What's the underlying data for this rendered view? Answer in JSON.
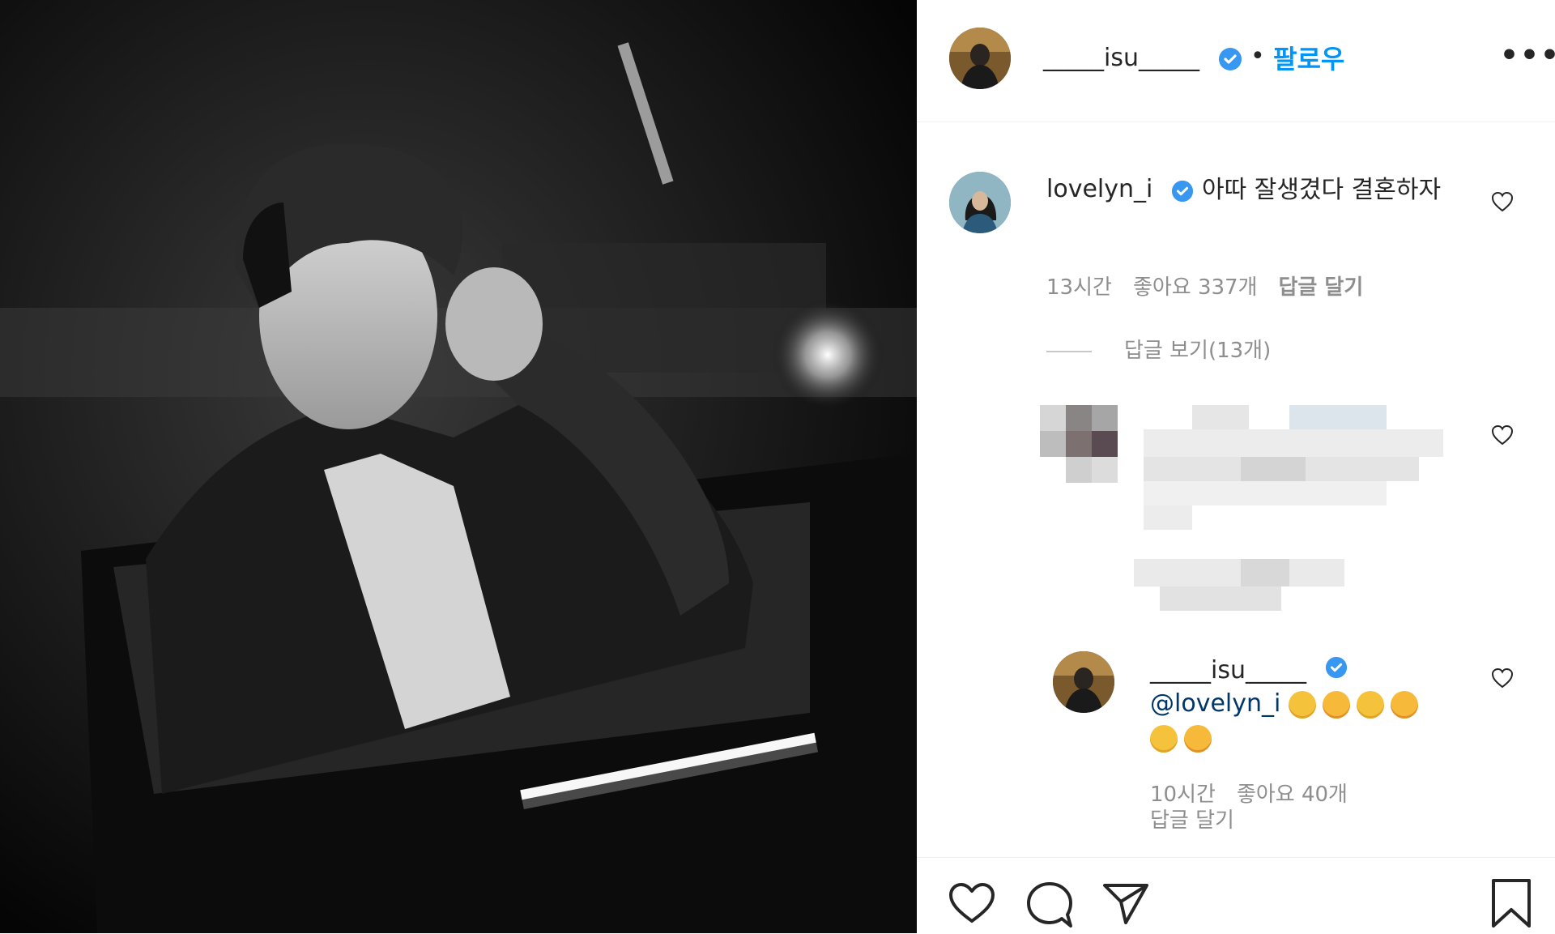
{
  "header": {
    "username": "_____isu_____",
    "separator": "•",
    "follow_label": "팔로우",
    "more_label": "•••"
  },
  "comments": [
    {
      "username": "lovelyn_i",
      "text": "아따 잘생겼다 결혼하자",
      "time": "13시간",
      "likes": "좋아요 337개",
      "reply_label": "답글 달기",
      "view_replies": "답글 보기(13개)"
    }
  ],
  "reply": {
    "username": "_____isu_____",
    "mention": "@lovelyn_i",
    "time": "10시간",
    "likes": "좋아요 40개",
    "reply_label": "답글 달기"
  },
  "icons": {
    "verified": "verified-badge-icon",
    "like": "heart-icon",
    "comment": "comment-icon",
    "share": "send-icon",
    "save": "bookmark-icon"
  },
  "colors": {
    "accent": "#0095f6",
    "verified": "#3897f0",
    "muted": "#8e8e8e",
    "text": "#262626"
  }
}
